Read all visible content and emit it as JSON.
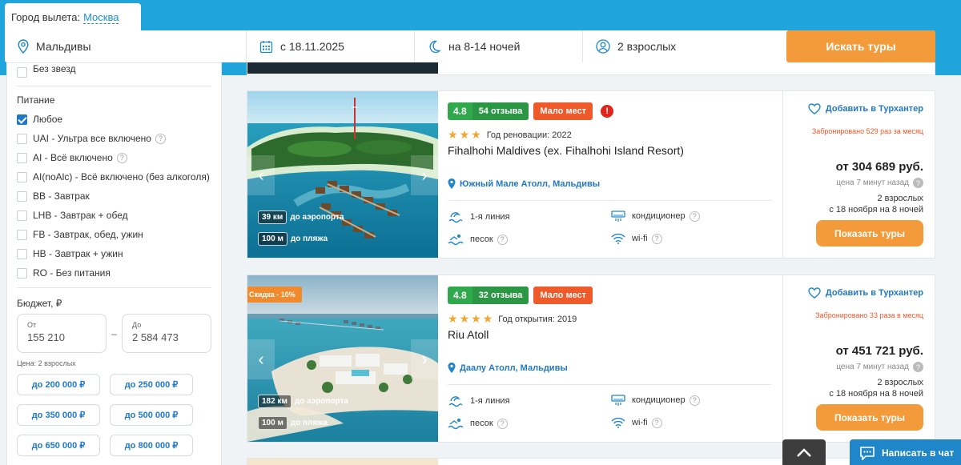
{
  "search": {
    "departure_label": "Город вылета:",
    "departure_city": "Москва",
    "destination": "Мальдивы",
    "date": "с 18.11.2025",
    "nights": "на 8-14 ночей",
    "people": "2 взрослых",
    "search_button": "Искать туры"
  },
  "filters": {
    "no_stars_label": "Без звезд",
    "meals_title": "Питание",
    "meals": [
      {
        "label": "Любое",
        "checked": true,
        "help": false
      },
      {
        "label": "UAI - Ультра все включено",
        "checked": false,
        "help": true
      },
      {
        "label": "AI - Всё включено",
        "checked": false,
        "help": true
      },
      {
        "label": "AI(noAlc) - Всё включено (без алкоголя)",
        "checked": false,
        "help": false
      },
      {
        "label": "BB - Завтрак",
        "checked": false,
        "help": false
      },
      {
        "label": "LHB - Завтрак + обед",
        "checked": false,
        "help": false
      },
      {
        "label": "FB - Завтрак, обед, ужин",
        "checked": false,
        "help": false
      },
      {
        "label": "HB - Завтрак + ужин",
        "checked": false,
        "help": false
      },
      {
        "label": "RO - Без питания",
        "checked": false,
        "help": false
      }
    ],
    "budget_title": "Бюджет, ₽",
    "budget_from_label": "От",
    "budget_from": "155 210",
    "budget_dash": "–",
    "budget_to_label": "До",
    "budget_to": "2 584 473",
    "budget_note": "Цена: 2 взрослых",
    "budget_chips": [
      "до 200 000 ₽",
      "до 250 000 ₽",
      "до 350 000 ₽",
      "до 500 000 ₽",
      "до 650 000 ₽",
      "до 800 000 ₽"
    ]
  },
  "hotels": [
    {
      "rating": "4.8",
      "reviews": "54 отзыва",
      "few_places": "Мало мест",
      "warning": "!",
      "stars": 3,
      "year_text": "Год реновации: 2022",
      "name": "Fihalhohi Maldives (ex. Fihalhohi Island Resort)",
      "location": "Южный Мале Атолл, Мальдивы",
      "airport_km": "39 км",
      "airport_label": "до аэропорта",
      "beach_m": "100 м",
      "beach_label": "до пляжа",
      "features": [
        "1-я линия",
        "кондиционер",
        "песок",
        "wi-fi"
      ],
      "favorite": "Добавить в Турхантер",
      "booked": "Забронировано 529 раз за месяц",
      "price": "от 304 689 руб.",
      "price_when": "цена 7 минут назад",
      "pax": "2 взрослых",
      "dates": "с 18 ноября на 8 ночей",
      "button": "Показать туры"
    },
    {
      "discount": "Скидка - 10%",
      "rating": "4.8",
      "reviews": "32 отзыва",
      "few_places": "Мало мест",
      "stars": 4,
      "year_text": "Год открытия: 2019",
      "name": "Riu Atoll",
      "location": "Даалу Атолл, Мальдивы",
      "airport_km": "182 км",
      "airport_label": "до аэропорта",
      "beach_m": "100 м",
      "beach_label": "до пляжа",
      "features": [
        "1-я линия",
        "кондиционер",
        "песок",
        "wi-fi"
      ],
      "favorite": "Добавить в Турхантер",
      "booked": "Забронировано 33 раза в месяц",
      "price": "от 451 721 руб.",
      "price_when": "цена 7 минут назад",
      "pax": "2 взрослых",
      "dates": "с 18 ноября на 8 ночей",
      "button": "Показать туры"
    }
  ],
  "chat_button": "Написать в чат",
  "colors": {
    "brand_blue": "#1fa5dc",
    "accent_orange": "#f39a3b",
    "rating_green": "#30a84c",
    "alert_red": "#ef5a2a",
    "link_blue": "#1f78c8"
  }
}
